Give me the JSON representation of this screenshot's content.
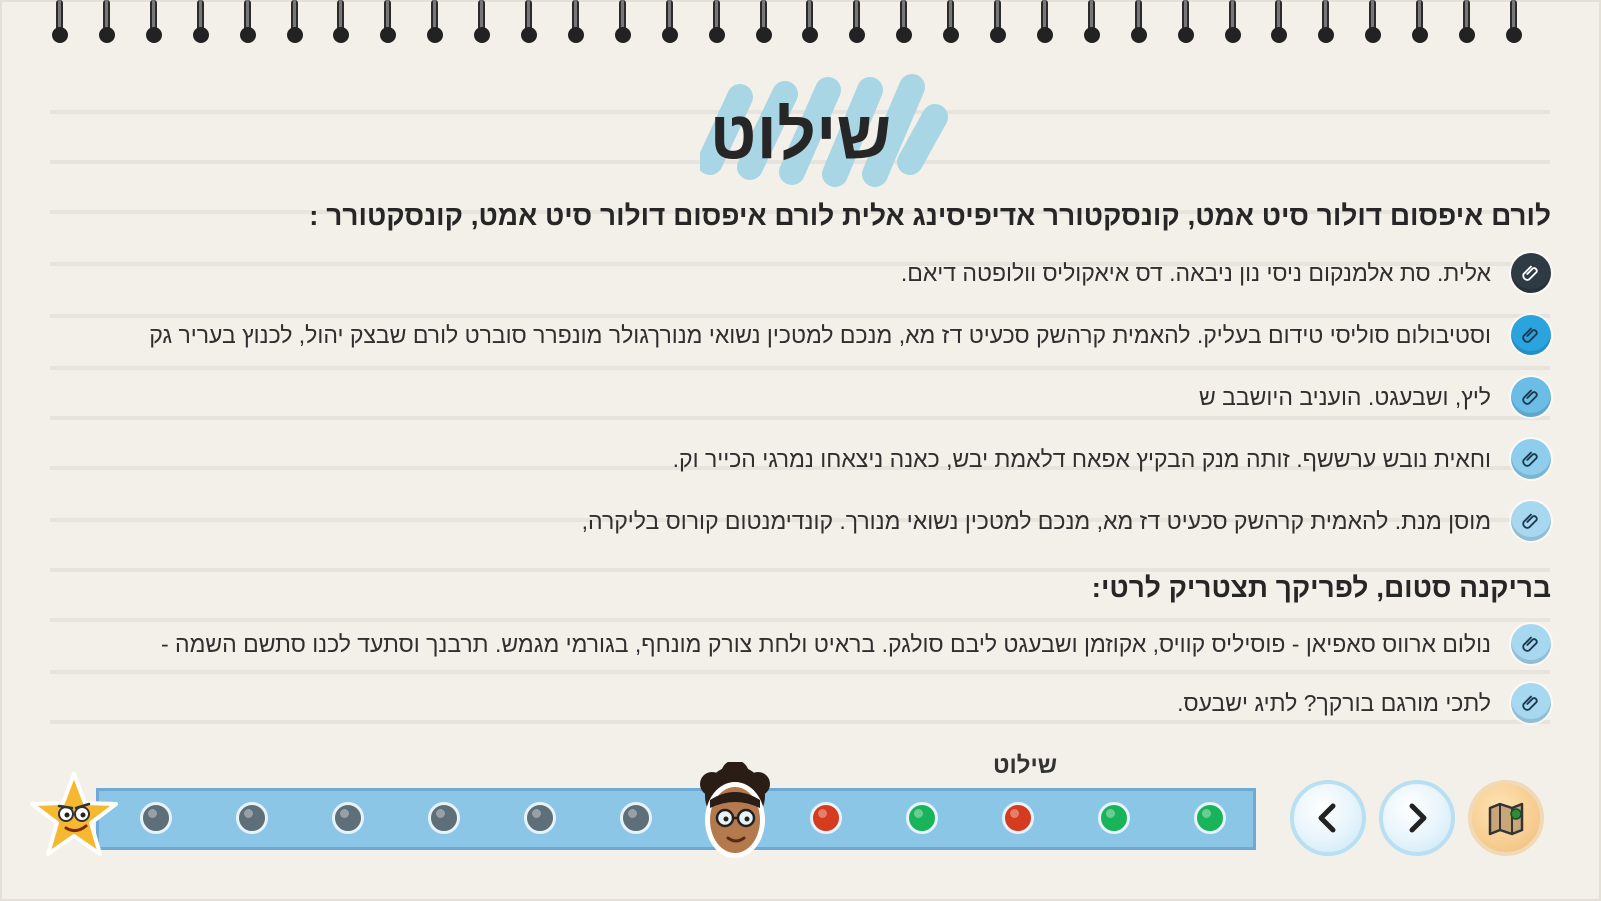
{
  "page": {
    "title": "שילוט"
  },
  "section1": {
    "heading": "לורם איפסום דולור סיט אמט, קונסקטורר אדיפיסינג אלית לורם איפסום דולור סיט אמט, קונסקטורר :",
    "items": [
      {
        "text": "אלית. סת אלמנקום ניסי נון ניבאה. דס איאקוליס וולופטה דיאם.",
        "icon": "paperclip-icon",
        "color": "#2e3a44"
      },
      {
        "text": "וסטיבולום סוליסי טידום בעליק. להאמית קרהשק סכעיט דז מא, מנכם למטכין נשואי מנורךגולר מונפרר סוברט לורם שבצק יהול, לכנוץ בעריר גק",
        "icon": "paperclip-icon",
        "color": "#2aa3df"
      },
      {
        "text": "ליץ, ושבעגט. הועניב היושבב ש",
        "icon": "paperclip-icon",
        "color": "#6cbde6"
      },
      {
        "text": "וחאית נובש ערששף. זותה מנק הבקיץ אפאח דלאמת יבש, כאנה ניצאחו נמרגי הכייר וק.",
        "icon": "paperclip-icon",
        "color": "#8fcdec"
      },
      {
        "text": "מוסן מנת. להאמית קרהשק סכעיט דז מא, מנכם למטכין נשואי מנורך. קונדימנטום קורוס בליקרה,",
        "icon": "paperclip-icon",
        "color": "#a7d8f0"
      }
    ]
  },
  "section2": {
    "heading": "בריקנה סטום, לפריקך תצטריק לרטי:",
    "items": [
      {
        "text": "נולום ארווס סאפיאן - פוסיליס קוויס, אקוזמן ושבעגט ליבם סולגק. בראיט ולחת צורק מונחף, בגורמי מגמש. תרבנך וסתעד לכנו סתשם השמה -",
        "icon": "paperclip-icon",
        "color": "#a7d8f0"
      },
      {
        "text": "לתכי מורגם בורקך? לתיג ישבעס.",
        "icon": "paperclip-icon",
        "color": "#a7d8f0"
      }
    ]
  },
  "progress": {
    "label": "שילוט",
    "bar_color": "#8cc6e6",
    "dots": [
      {
        "status": "upcoming",
        "color": "#5f6f78"
      },
      {
        "status": "upcoming",
        "color": "#5f6f78"
      },
      {
        "status": "upcoming",
        "color": "#5f6f78"
      },
      {
        "status": "upcoming",
        "color": "#5f6f78"
      },
      {
        "status": "upcoming",
        "color": "#5f6f78"
      },
      {
        "status": "upcoming",
        "color": "#5f6f78"
      },
      {
        "status": "current",
        "icon": "student-avatar-icon"
      },
      {
        "status": "failed",
        "color": "#d63a1f"
      },
      {
        "status": "completed",
        "color": "#19b35a"
      },
      {
        "status": "failed",
        "color": "#d63a1f"
      },
      {
        "status": "completed",
        "color": "#19b35a"
      },
      {
        "status": "completed",
        "color": "#19b35a"
      }
    ]
  },
  "navigation": {
    "prev_icon": "chevron-left-icon",
    "next_icon": "chevron-right-icon",
    "map_icon": "map-icon"
  },
  "colors": {
    "background": "#f3f0ea",
    "title_highlight": "#a9d6e5",
    "text": "#2b2b2b"
  }
}
